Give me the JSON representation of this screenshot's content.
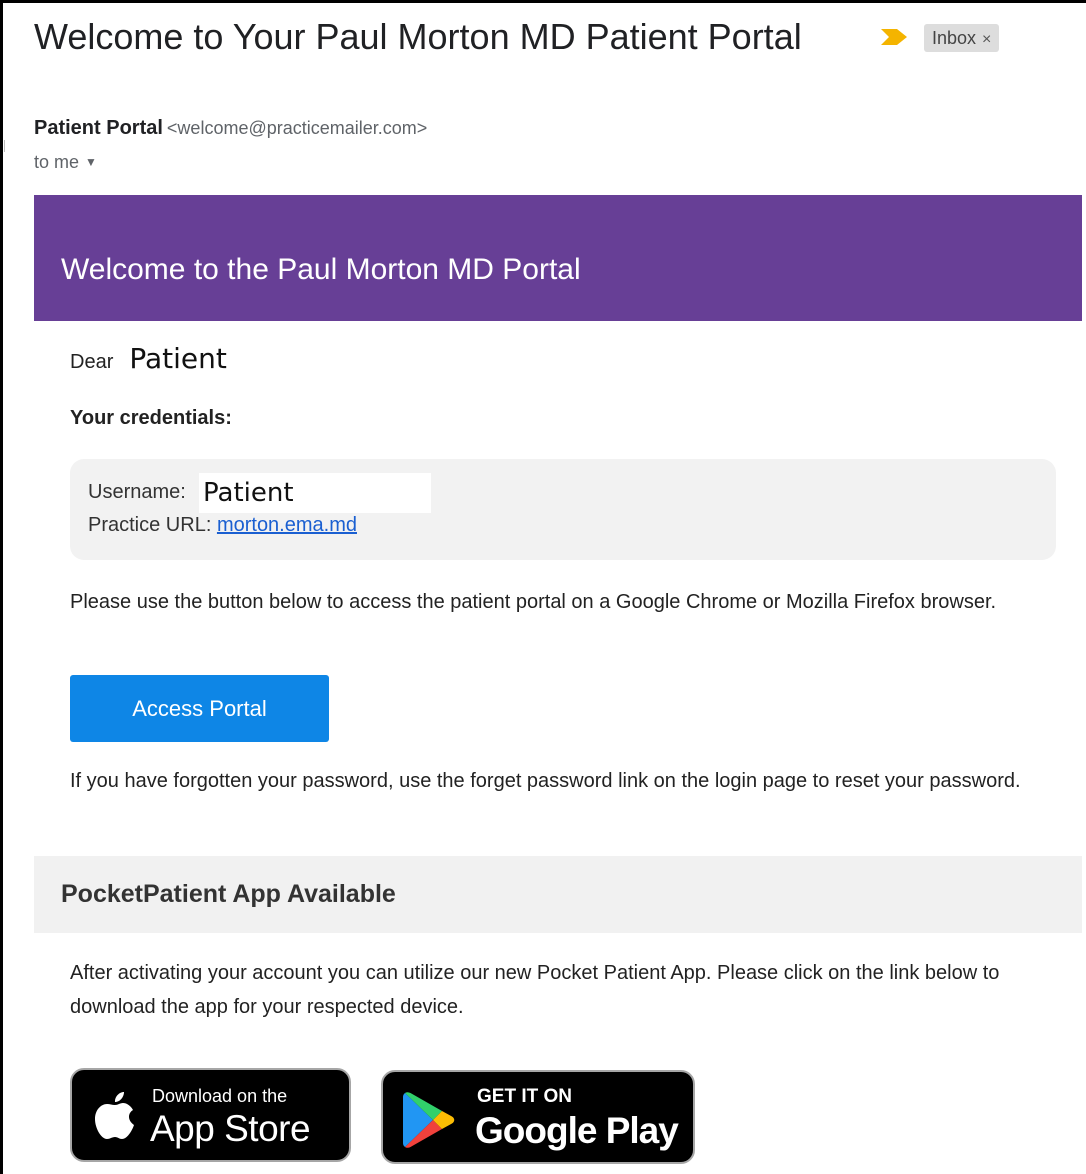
{
  "email": {
    "subject": "Welcome to Your Paul Morton MD Patient Portal",
    "label": "Inbox",
    "label_close": "×",
    "sender_name": "Patient Portal",
    "sender_address": "<welcome@practicemailer.com>",
    "recipients": "to me",
    "recipients_caret": "▼"
  },
  "body": {
    "hero_title": "Welcome to the Paul Morton MD Portal",
    "hero_color": "#673f96",
    "greeting_word": "Dear",
    "greeting_name": "Patient",
    "credentials_heading": "Your credentials:",
    "username_label": "Username:",
    "username_value": "Patient",
    "practice_url_label": "Practice URL:",
    "practice_url": "morton.ema.md",
    "instruction": "Please use the button below to access the patient portal on a Google Chrome or Mozilla Firefox browser.",
    "access_button": "Access Portal",
    "access_button_color": "#0e86e6",
    "password_note": "If you have forgotten your password, use the forget password link on the login page to reset your password.",
    "app_heading": "PocketPatient App Available",
    "app_text": "After activating your account you can utilize our new Pocket Patient App. Please click on the link below to download the app for your respected device."
  },
  "badges": {
    "appstore_small": "Download on the",
    "appstore_big": "App Store",
    "appstore_icon": "apple-icon",
    "gplay_small": "GET IT ON",
    "gplay_big": "Google Play",
    "gplay_icon": "google-play-icon"
  }
}
